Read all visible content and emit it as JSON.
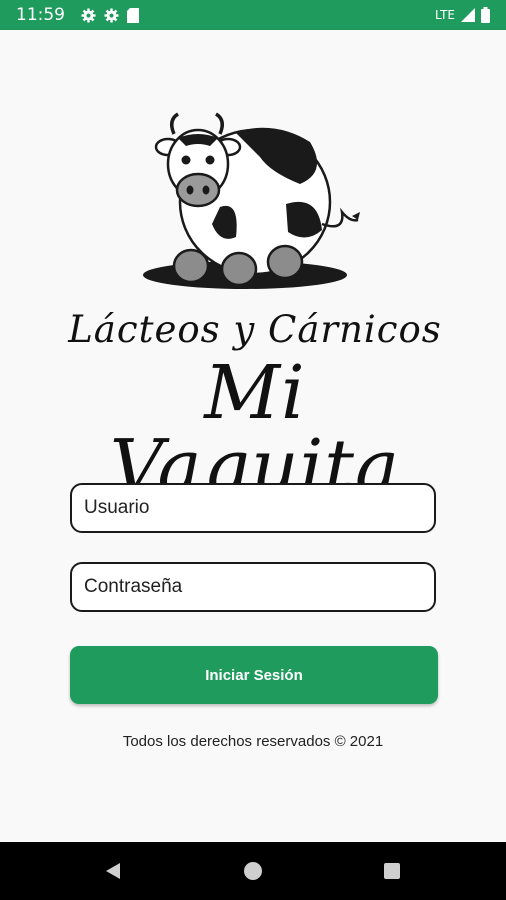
{
  "status_bar": {
    "time": "11:59",
    "network": "LTE",
    "icons": [
      "settings-icon",
      "settings-icon",
      "sd-card-icon",
      "signal-icon",
      "battery-icon"
    ],
    "color": "#1e9b5d"
  },
  "logo": {
    "tagline": "Lácteos y Cárnicos",
    "brand": "Mi Vaquita",
    "icon": "cow-logo-icon"
  },
  "login": {
    "username_placeholder": "Usuario",
    "password_placeholder": "Contraseña",
    "submit_label": "Iniciar Sesión",
    "accent_color": "#1e9b5d"
  },
  "footer": {
    "text": "Todos los derechos reservados © 2021"
  },
  "nav_bar": {
    "icons": [
      "back-icon",
      "home-icon",
      "recents-icon"
    ]
  }
}
